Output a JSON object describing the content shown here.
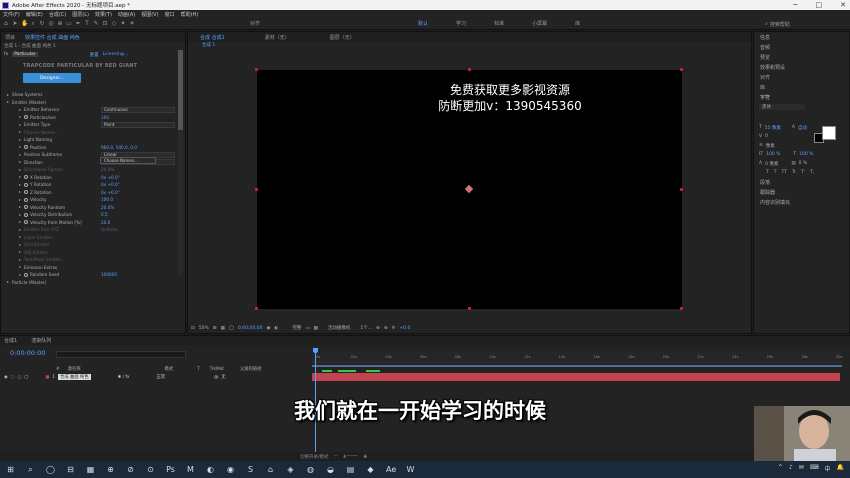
{
  "window": {
    "title": "Adobe After Effects 2020 - 无标题项目.aep *",
    "minimize": "─",
    "maximize": "□",
    "close": "✕"
  },
  "menu": [
    "文件(F)",
    "编辑(E)",
    "合成(C)",
    "图层(L)",
    "效果(T)",
    "动画(A)",
    "视图(V)",
    "窗口",
    "帮助(H)"
  ],
  "toolbar_right": {
    "snap": "对齐",
    "default": "默认",
    "learn": "学习",
    "standard": "标准",
    "small_screen": "小屏幕",
    "libraries": "库",
    "search_help": "搜索帮助"
  },
  "effect_panel": {
    "tabs": [
      "项目",
      "效果控件 合成 曲面 纯色"
    ],
    "subheader": "合成 1 · 合成 曲面 纯色 1",
    "fx_name": "Particular",
    "reset_label": "重置",
    "license_label": "Licensing...",
    "logo_text": "TRAPCODE PARTICULAR BY RED GIANT",
    "designer_button": "Designer...",
    "tooltip": "Choose Names...",
    "properties": [
      {
        "label": "Show Systems",
        "value": "",
        "indent": 0,
        "kind": "group"
      },
      {
        "label": "Emitter (Master)",
        "value": "",
        "indent": 0,
        "kind": "group"
      },
      {
        "label": "Emitter Behavior",
        "value": "Continuous",
        "indent": 1,
        "kind": "dropdown"
      },
      {
        "label": "Particles/sec",
        "value": "100",
        "indent": 1,
        "kind": "stopwatch"
      },
      {
        "label": "Emitter Type",
        "value": "Point",
        "indent": 1,
        "kind": "dropdown"
      },
      {
        "label": "Choose Names...",
        "value": "",
        "indent": 1,
        "kind": "dim"
      },
      {
        "label": "Light Naming",
        "value": "",
        "indent": 1,
        "kind": "plain"
      },
      {
        "label": "Position",
        "value": "960.0, 540.0, 0.0",
        "indent": 1,
        "kind": "stopwatch"
      },
      {
        "label": "Position Subframe",
        "value": "Linear",
        "indent": 1,
        "kind": "dropdown"
      },
      {
        "label": "Direction",
        "value": "Uniform",
        "indent": 1,
        "kind": "dropdown"
      },
      {
        "label": "Directional Spread",
        "value": "20.0%",
        "indent": 1,
        "kind": "dim"
      },
      {
        "label": "X Rotation",
        "value": "0x +0.0°",
        "indent": 1,
        "kind": "stopwatch"
      },
      {
        "label": "Y Rotation",
        "value": "0x +0.0°",
        "indent": 1,
        "kind": "stopwatch"
      },
      {
        "label": "Z Rotation",
        "value": "0x +0.0°",
        "indent": 1,
        "kind": "stopwatch"
      },
      {
        "label": "Velocity",
        "value": "100.0",
        "indent": 1,
        "kind": "stopwatch"
      },
      {
        "label": "Velocity Random",
        "value": "20.0%",
        "indent": 1,
        "kind": "stopwatch"
      },
      {
        "label": "Velocity Distribution",
        "value": "0.5",
        "indent": 1,
        "kind": "stopwatch"
      },
      {
        "label": "Velocity from Motion [%]",
        "value": "20.0",
        "indent": 1,
        "kind": "stopwatch"
      },
      {
        "label": "Emitter Size XYZ",
        "value": "Uniform",
        "indent": 1,
        "kind": "dim"
      },
      {
        "label": "Layer Emitter",
        "value": "",
        "indent": 1,
        "kind": "dimgroup"
      },
      {
        "label": "Grid Emitter",
        "value": "",
        "indent": 1,
        "kind": "dimgroup"
      },
      {
        "label": "OBJ Emitter",
        "value": "",
        "indent": 1,
        "kind": "dimgroup"
      },
      {
        "label": "Text/Mask Emitter",
        "value": "",
        "indent": 1,
        "kind": "dimgroup"
      },
      {
        "label": "Emission Extras",
        "value": "",
        "indent": 1,
        "kind": "group"
      },
      {
        "label": "Random Seed",
        "value": "100000",
        "indent": 1,
        "kind": "stopwatch"
      },
      {
        "label": "Particle (Master)",
        "value": "",
        "indent": 0,
        "kind": "group"
      }
    ]
  },
  "comp_panel": {
    "tabs": [
      "合成 合成1",
      "素材（无）",
      "图层（无）"
    ],
    "comp_tab": "合成 1",
    "watermark_line1": "免费获取更多影视资源",
    "watermark_line2": "防断更加v：1390545360",
    "zoom": "50%",
    "timecode": "0;00;00;00",
    "resolution": "完整",
    "camera": "活动摄像机",
    "views": "1个...",
    "exposure": "+0.0"
  },
  "right_panel": {
    "items": [
      "信息",
      "音频",
      "预览",
      "效果和预设",
      "对齐",
      "库"
    ],
    "character_header": "字符",
    "font": "黑体",
    "font_size": "55 像素",
    "leading": "自动",
    "tracking": "0",
    "stroke": "像素",
    "scale_v": "100 %",
    "scale_h": "100 %",
    "baseline": "0 像素",
    "tsume": "0 %",
    "styles": [
      "T",
      "T",
      "TT",
      "Tr",
      "T'",
      "T,"
    ],
    "lower_items": [
      "段落",
      "跟踪器",
      "内容识别填充"
    ]
  },
  "timeline": {
    "tabs": [
      "合成1",
      "渲染队列"
    ],
    "timecode": "0:00:00:00",
    "columns": [
      "#",
      "源名称",
      "模式",
      "T",
      "TrkMat",
      "父级和链接"
    ],
    "layer": {
      "index": "1",
      "name": "合成 曲面 纯色",
      "mode": "正常",
      "parent": "无"
    },
    "ruler_ticks": [
      "0s",
      "02s",
      "04s",
      "06s",
      "08s",
      "10s",
      "12s",
      "14s",
      "16s",
      "18s",
      "20s",
      "22s",
      "24s",
      "26s",
      "28s",
      "30s"
    ],
    "bottom_label": "切换开关/模式"
  },
  "subtitle": "我们就在一开始学习的时候",
  "taskbar": {
    "icons": [
      "⊞",
      "⌕",
      "◯",
      "⊟",
      "▦",
      "⊕",
      "⊘",
      "⊙",
      "Ps",
      "M",
      "◐",
      "◉",
      "S",
      "⌂",
      "◈",
      "◍",
      "◒",
      "▤",
      "◆",
      "Ae",
      "W"
    ],
    "tray": [
      "^",
      "♪",
      "✉",
      "⌨",
      "中",
      "🔔"
    ]
  },
  "colors": {
    "accent_blue": "#5aa0ff",
    "layer_red": "#c24451",
    "designer_button": "#3a8fd8"
  }
}
